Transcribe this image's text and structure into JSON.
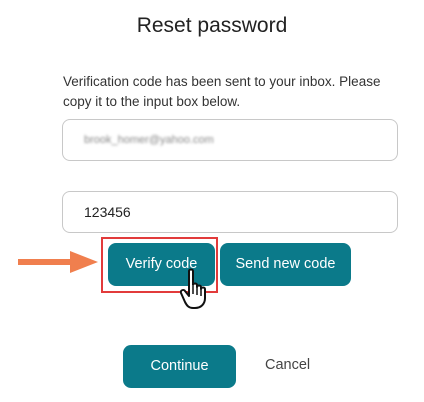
{
  "page": {
    "title": "Reset password",
    "description": "Verification code has been sent to your inbox. Please copy it to the input box below."
  },
  "form": {
    "email_value": "brook_homer@yahoo.com",
    "code_value": "123456"
  },
  "buttons": {
    "verify_label": "Verify code",
    "send_new_label": "Send new code",
    "continue_label": "Continue",
    "cancel_label": "Cancel"
  },
  "annotations": {
    "arrow_icon": "arrow-right-icon",
    "arrow_color": "#f07f4e",
    "highlight_color": "#e23b3b",
    "cursor_icon": "hand-pointer-icon"
  },
  "colors": {
    "primary_button": "#0b7a8a",
    "button_text": "#ffffff"
  }
}
